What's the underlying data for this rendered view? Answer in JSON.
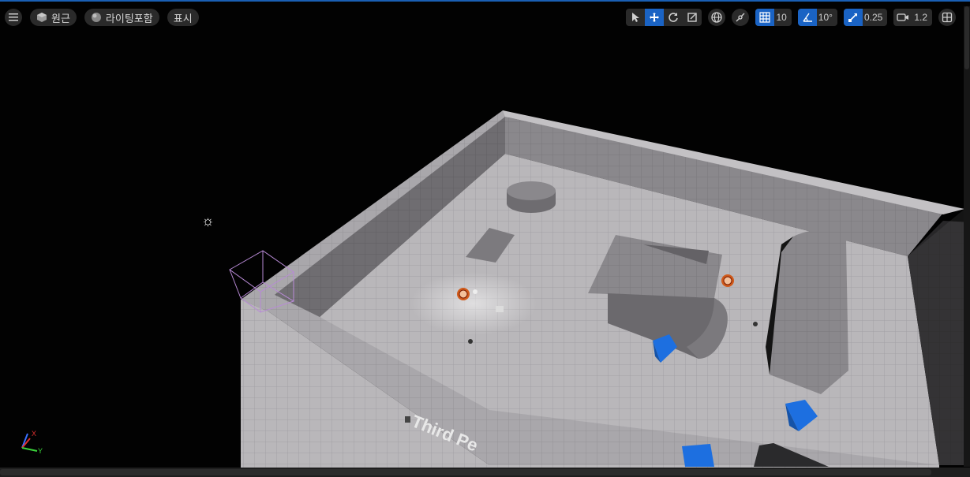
{
  "toolbar_left": {
    "menu_icon": "hamburger-icon",
    "perspective_label": "원근",
    "lighting_label": "라이팅포함",
    "show_label": "표시"
  },
  "toolbar_right": {
    "grid_snap_value": "10",
    "rotation_snap_value": "10°",
    "scale_snap_value": "0.25",
    "camera_speed_value": "1.2"
  },
  "scene": {
    "floor_text": "Third Pe"
  },
  "colors": {
    "accent": "#1a63c4",
    "toolbar_bg": "#2a2a2a",
    "cube": "#1d6fe0"
  }
}
